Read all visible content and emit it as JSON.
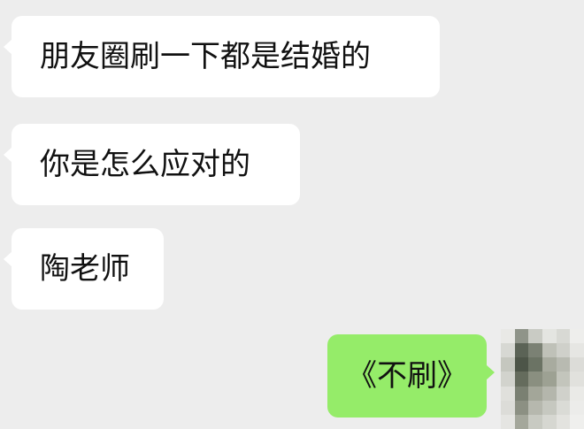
{
  "conversation": {
    "messages": [
      {
        "side": "incoming",
        "text": "朋友圈刷一下都是结婚的"
      },
      {
        "side": "incoming",
        "text": "你是怎么应对的"
      },
      {
        "side": "incoming",
        "text": "陶老师"
      },
      {
        "side": "outgoing",
        "text": "《不刷》"
      }
    ]
  },
  "colors": {
    "background": "#ededed",
    "incoming_bubble": "#ffffff",
    "outgoing_bubble": "#95ec69",
    "text": "#111111"
  },
  "icons": {
    "avatar": "pixelated-avatar"
  }
}
